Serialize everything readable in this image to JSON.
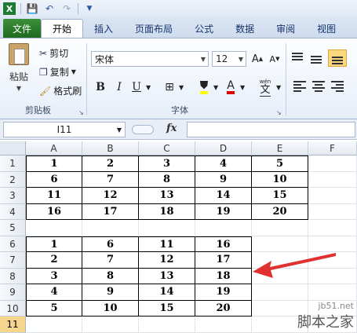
{
  "ribbon_tabs": [
    "文件",
    "开始",
    "插入",
    "页面布局",
    "公式",
    "数据",
    "审阅",
    "视图"
  ],
  "clipboard": {
    "paste": "粘贴",
    "cut": "剪切",
    "copy": "复制",
    "format_painter": "格式刷",
    "group": "剪贴板"
  },
  "font": {
    "name": "宋体",
    "size": "12",
    "bold": "B",
    "italic": "I",
    "underline": "U",
    "font_color_letter": "A",
    "phonetic": "wén",
    "phonetic_char": "文",
    "grow": "A",
    "shrink": "A",
    "group": "字体"
  },
  "formula_bar": {
    "name_box": "I11",
    "fx": "fx",
    "formula": ""
  },
  "columns": [
    "A",
    "B",
    "C",
    "D",
    "E",
    "F"
  ],
  "rows": [
    "1",
    "2",
    "3",
    "4",
    "5",
    "6",
    "7",
    "8",
    "9",
    "10",
    "11"
  ],
  "selected_row": "11",
  "table1": [
    [
      "1",
      "2",
      "3",
      "4",
      "5"
    ],
    [
      "6",
      "7",
      "8",
      "9",
      "10"
    ],
    [
      "11",
      "12",
      "13",
      "14",
      "15"
    ],
    [
      "16",
      "17",
      "18",
      "19",
      "20"
    ]
  ],
  "table2": [
    [
      "1",
      "6",
      "11",
      "16"
    ],
    [
      "2",
      "7",
      "12",
      "17"
    ],
    [
      "3",
      "8",
      "13",
      "18"
    ],
    [
      "4",
      "9",
      "14",
      "19"
    ],
    [
      "5",
      "10",
      "15",
      "20"
    ]
  ],
  "watermark": {
    "url": "jb51.net",
    "name": "脚本之家"
  },
  "colors": {
    "file_tab": "#1f6a1f",
    "arrow": "#e03030",
    "selected_row": "#f6d58c"
  }
}
